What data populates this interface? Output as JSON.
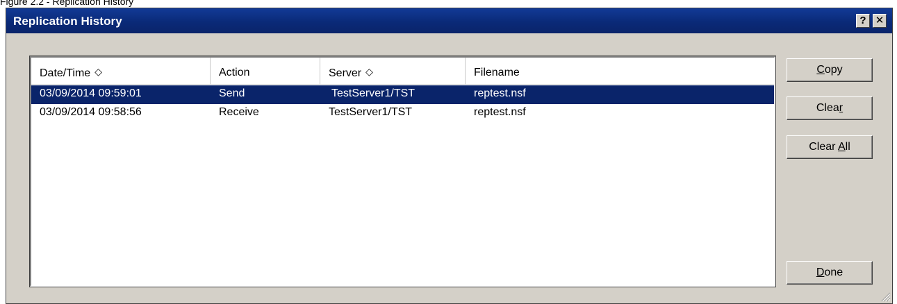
{
  "caption": "Figure 2.2 - Replication History",
  "window": {
    "title": "Replication History",
    "help_label": "?",
    "close_label": "✕"
  },
  "list": {
    "columns": [
      {
        "label": "Date/Time",
        "sortable": true
      },
      {
        "label": "Action",
        "sortable": false
      },
      {
        "label": "Server",
        "sortable": true
      },
      {
        "label": "Filename",
        "sortable": false
      }
    ],
    "sort_glyph": "◇",
    "rows": [
      {
        "datetime": "03/09/2014 09:59:01",
        "action": "Send",
        "server": "TestServer1/TST",
        "filename": "reptest.nsf",
        "selected": true
      },
      {
        "datetime": "03/09/2014 09:58:56",
        "action": "Receive",
        "server": "TestServer1/TST",
        "filename": "reptest.nsf",
        "selected": false
      }
    ]
  },
  "buttons": {
    "copy": {
      "pre": "",
      "u": "C",
      "post": "opy"
    },
    "clear": {
      "pre": "Clea",
      "u": "r",
      "post": ""
    },
    "clear_all": {
      "pre": "Clear ",
      "u": "A",
      "post": "ll"
    },
    "done": {
      "pre": "",
      "u": "D",
      "post": "one"
    }
  },
  "colors": {
    "titlebar": "#0a246a",
    "selection": "#0a246a",
    "dialog_bg": "#d4d0c8"
  }
}
